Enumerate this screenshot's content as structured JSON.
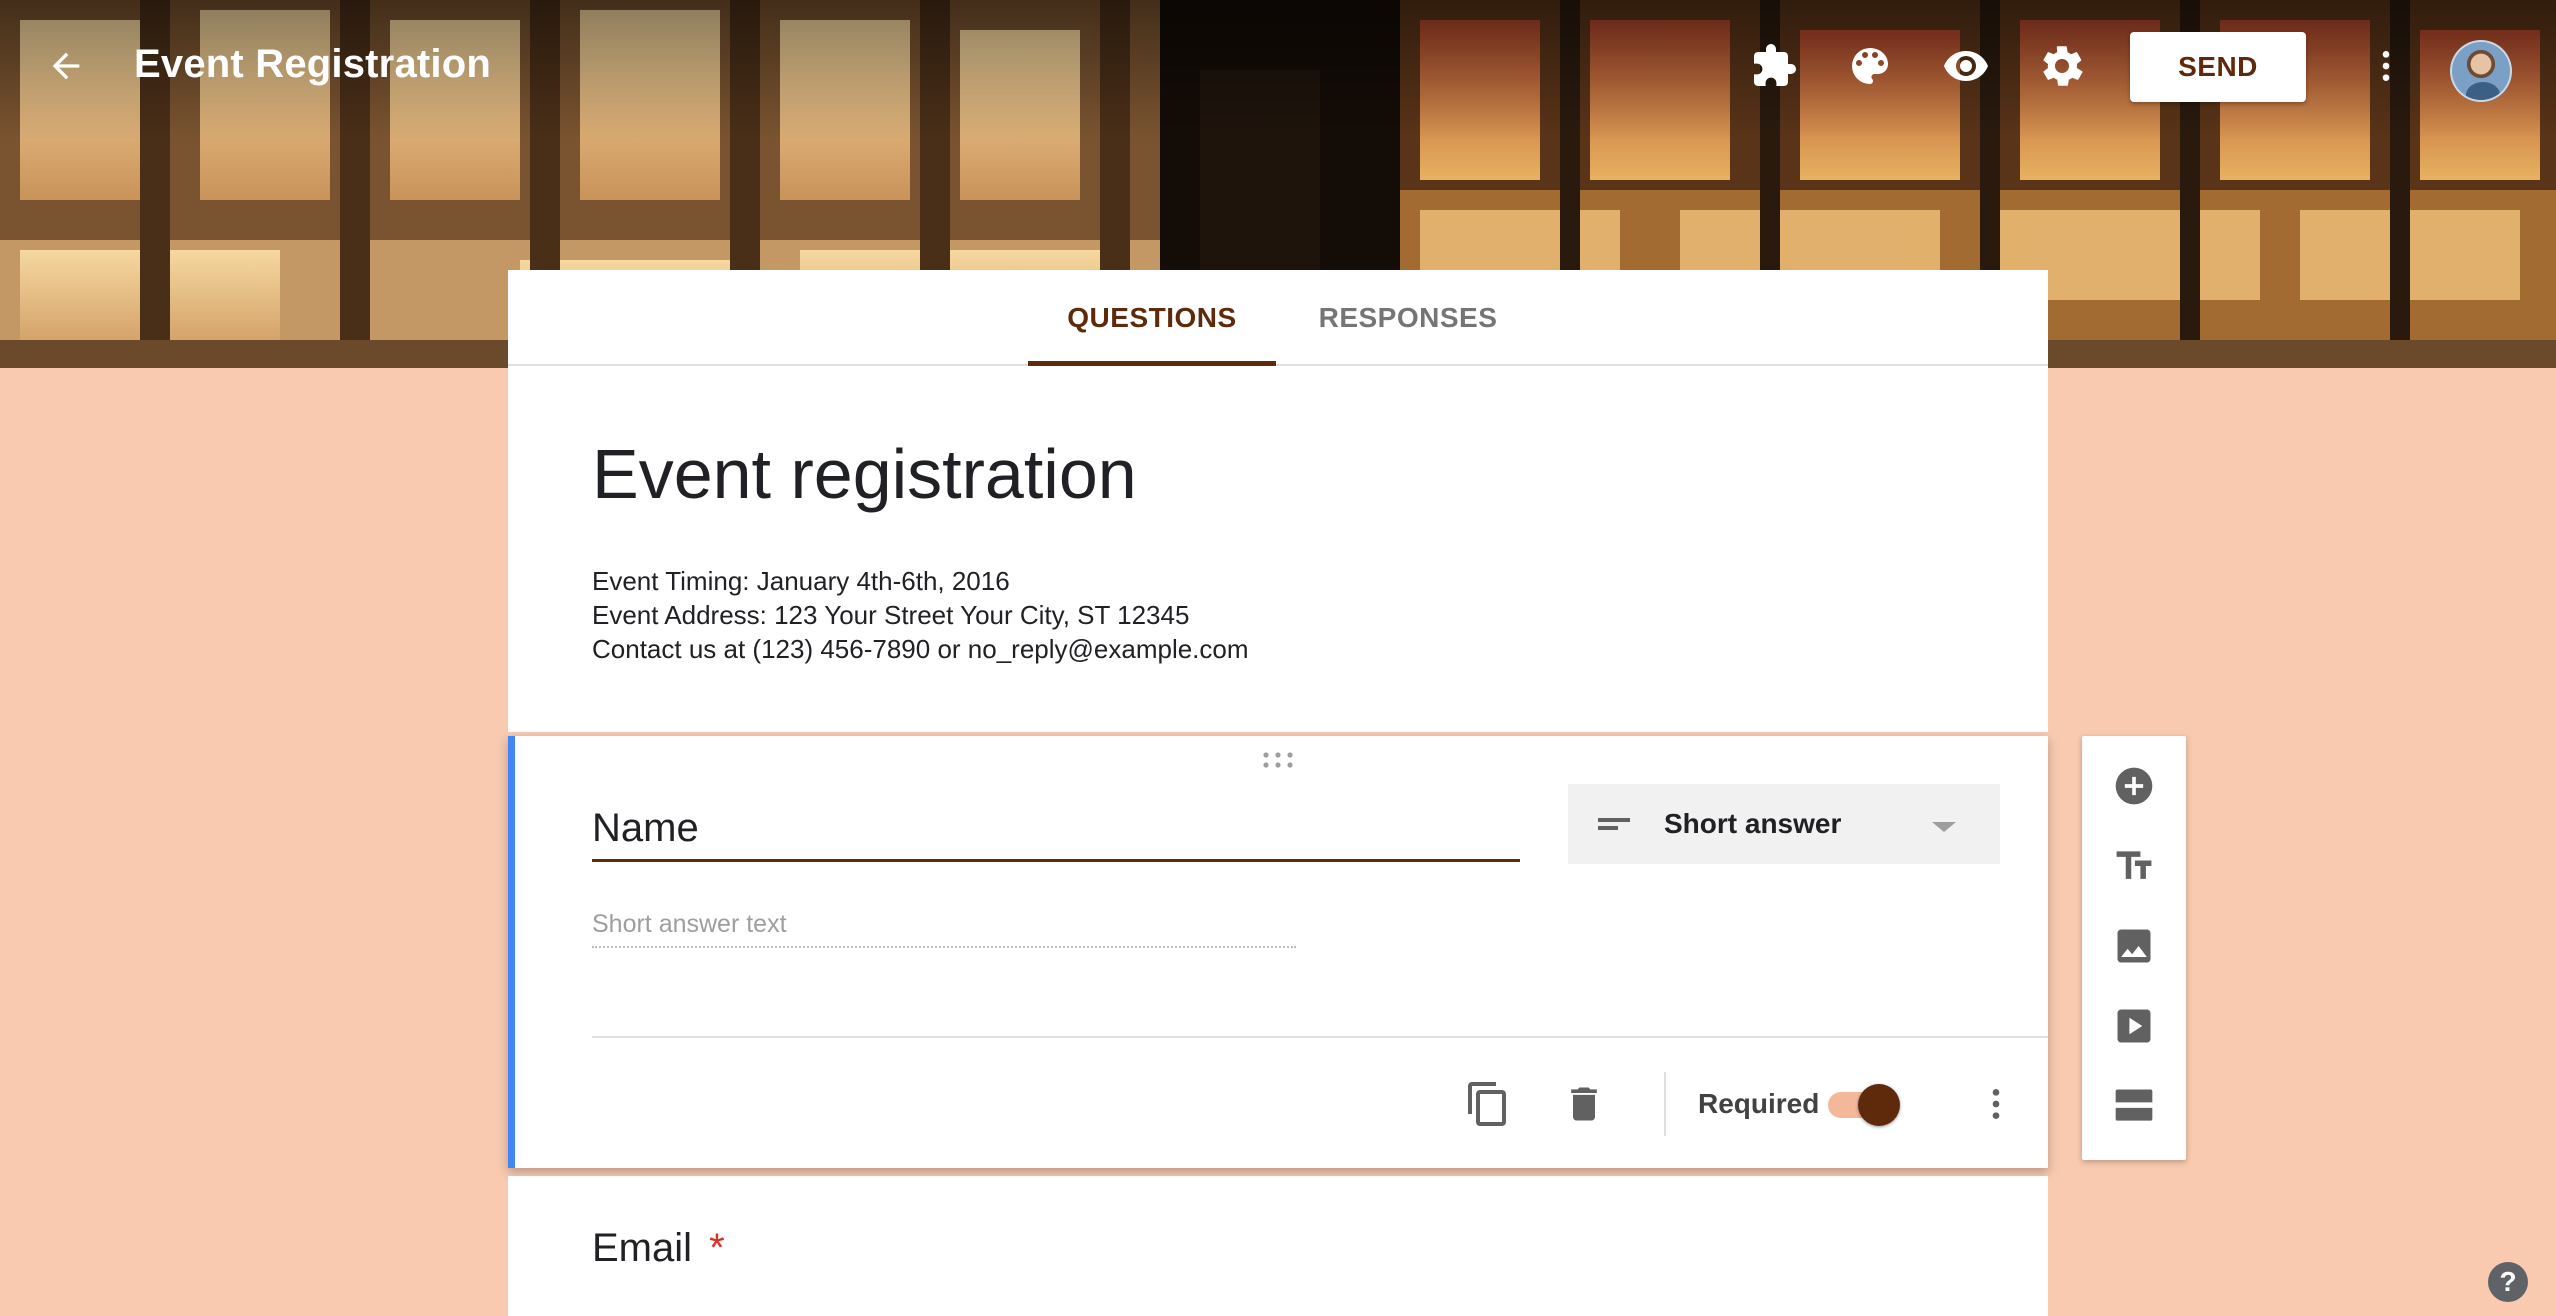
{
  "header": {
    "title": "Event Registration",
    "send_label": "SEND",
    "icons": [
      "back-arrow-icon",
      "add-ons-puzzle-icon",
      "palette-icon",
      "preview-eye-icon",
      "settings-gear-icon",
      "more-vert-icon"
    ]
  },
  "tabs": [
    {
      "label": "QUESTIONS",
      "active": true
    },
    {
      "label": "RESPONSES",
      "active": false
    }
  ],
  "form": {
    "title": "Event registration",
    "description": [
      "Event Timing: January 4th-6th, 2016",
      "Event Address: 123 Your Street Your City, ST 12345",
      "Contact us at (123) 456-7890 or no_reply@example.com"
    ]
  },
  "question": {
    "title": "Name",
    "type": "Short answer",
    "answer_placeholder": "Short answer text",
    "required_label": "Required",
    "required": true
  },
  "next_question": {
    "title": "Email",
    "required_mark": "*"
  },
  "side_toolbar": [
    "add-question-icon",
    "add-title-icon",
    "add-image-icon",
    "add-video-icon",
    "add-section-icon"
  ],
  "help": {
    "label": "?"
  },
  "colors": {
    "accent": "#5f2a0c",
    "background": "#f9c9b0",
    "question_accent": "#4285f4",
    "toggle_track": "#f3b89a"
  }
}
